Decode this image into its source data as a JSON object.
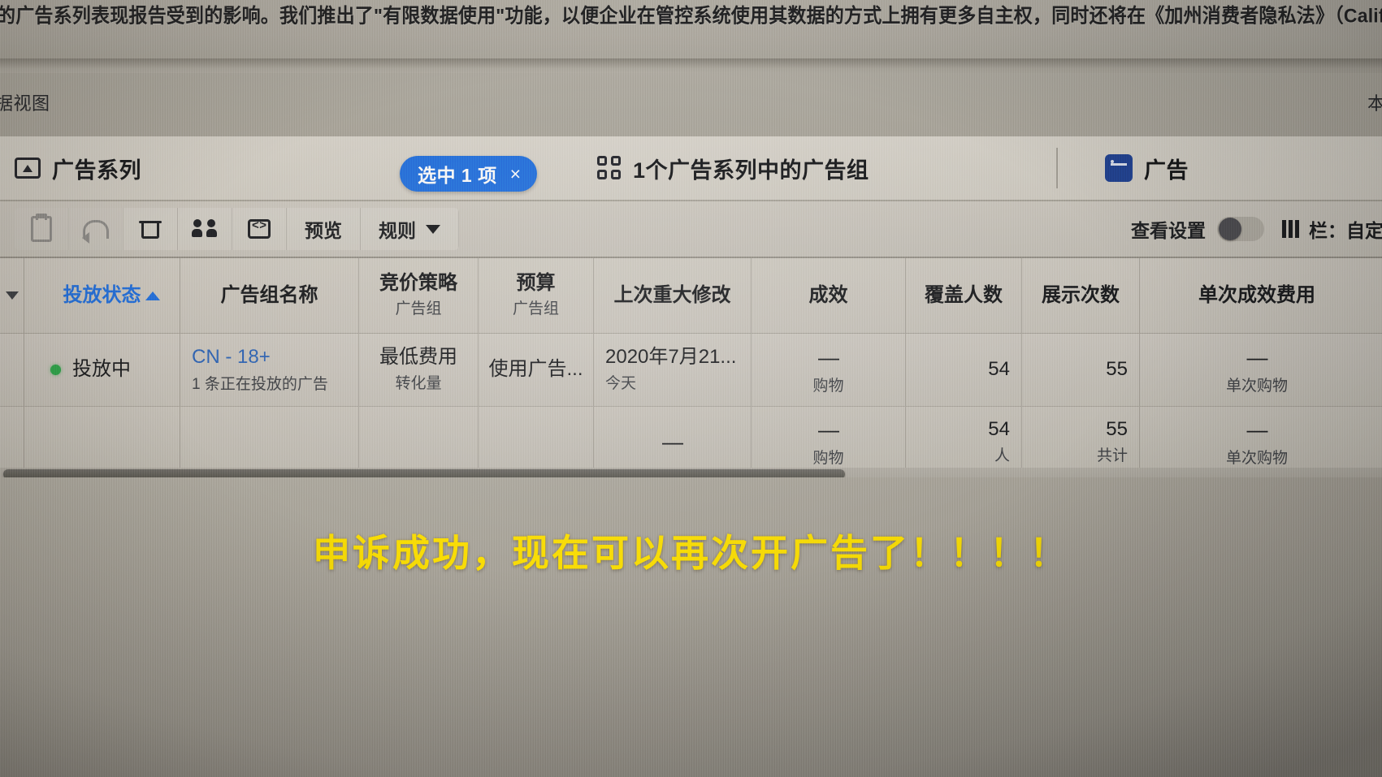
{
  "notice": {
    "text": "的广告系列表现报告受到的影响。我们推出了\"有限数据使用\"功能，以便企业在管控系统使用其数据的方式上拥有更多自主权，同时还将在《加州消费者隐私法》（California C",
    "latin_tail": "California C"
  },
  "page_chrome": {
    "view_label": "据视图",
    "right_label": "本"
  },
  "tabs": [
    {
      "label": "广告系列",
      "icon": "folder-icon",
      "active": false
    },
    {
      "label": "1个广告系列中的广告组",
      "icon": "grid-icon",
      "active": true
    },
    {
      "label": "广告",
      "icon": "ad-card-icon",
      "active": false
    }
  ],
  "selection_pill": {
    "label": "选中 1 项",
    "close": "×",
    "color": "#1f6fe0"
  },
  "toolbar": {
    "icon_buttons": [
      {
        "name": "duplicate-icon",
        "disabled": true
      },
      {
        "name": "undo-icon",
        "disabled": true
      },
      {
        "name": "delete-icon",
        "disabled": false
      },
      {
        "name": "audience-icon",
        "disabled": false
      },
      {
        "name": "export-icon",
        "disabled": false
      }
    ],
    "preview_label": "预览",
    "rules_label": "规则",
    "view_settings_label": "查看设置",
    "view_settings_on": false,
    "columns_label": "栏：自定"
  },
  "table": {
    "columns": [
      {
        "key": "status",
        "title": "投放状态",
        "sub": "",
        "sorted": true,
        "sort_dir": "asc"
      },
      {
        "key": "name",
        "title": "广告组名称",
        "sub": ""
      },
      {
        "key": "bid",
        "title": "竞价策略",
        "sub": "广告组"
      },
      {
        "key": "budget",
        "title": "预算",
        "sub": "广告组"
      },
      {
        "key": "modified",
        "title": "上次重大修改",
        "sub": ""
      },
      {
        "key": "results",
        "title": "成效",
        "sub": ""
      },
      {
        "key": "reach",
        "title": "覆盖人数",
        "sub": ""
      },
      {
        "key": "impressions",
        "title": "展示次数",
        "sub": ""
      },
      {
        "key": "cost_per_result",
        "title": "单次成效费用",
        "sub": ""
      }
    ],
    "rows": [
      {
        "status": "投放中",
        "status_color": "#2aa64a",
        "name": "CN - 18+",
        "name_sub": "1 条正在投放的广告",
        "bid": "最低费用",
        "bid_sub": "转化量",
        "budget": "使用广告...",
        "modified": "2020年7月21...",
        "modified_sub": "今天",
        "results": "—",
        "results_sub": "购物",
        "reach": "54",
        "impressions": "55",
        "cost_per_result": "—",
        "cost_per_result_sub": "单次购物"
      }
    ],
    "summary": {
      "modified": "—",
      "results": "—",
      "results_sub": "购物",
      "reach": "54",
      "reach_sub": "人",
      "impressions": "55",
      "impressions_sub": "共计",
      "cost_per_result": "—",
      "cost_per_result_sub": "单次购物"
    }
  },
  "caption": {
    "text": "申诉成功，现在可以再次开广告了！！！！",
    "color": "#ffe200"
  }
}
